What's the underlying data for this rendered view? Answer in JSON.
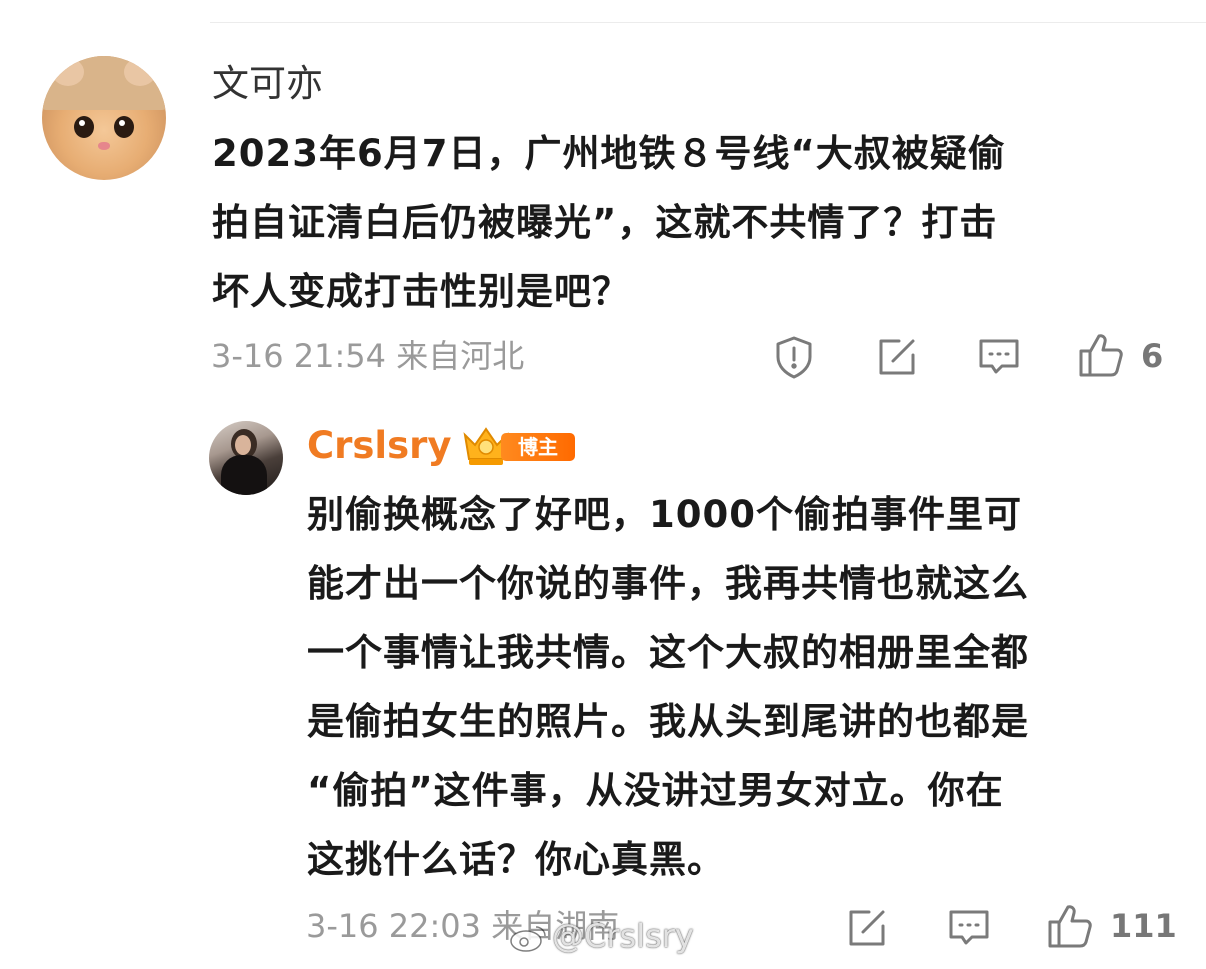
{
  "comment": {
    "author": "文可亦",
    "text_lines": [
      "2023年6月7日，广州地铁８号线“大叔被疑偷",
      "拍自证清白后仍被曝光”，这就不共情了？打击",
      "坏人变成打击性别是吧？"
    ],
    "meta": "3-16 21:54 来自河北",
    "like_count": "6",
    "icons": {
      "report": "shield-alert-icon",
      "forward": "edit-forward-icon",
      "reply": "comment-icon",
      "like": "thumbs-up-icon"
    }
  },
  "reply": {
    "author": "Crslsry",
    "badge": "博主",
    "text_lines": [
      "别偷换概念了好吧，1000个偷拍事件里可",
      "能才出一个你说的事件，我再共情也就这么",
      "一个事情让我共情。这个大叔的相册里全都",
      "是偷拍女生的照片。我从头到尾讲的也都是",
      "“偷拍”这件事，从没讲过男女对立。你在",
      "这挑什么话？你心真黑。"
    ],
    "meta": "3-16 22:03 来自湖南",
    "like_count": "111",
    "icons": {
      "forward": "edit-forward-icon",
      "reply": "comment-icon",
      "like": "thumbs-up-icon"
    }
  },
  "watermark": "@Crslsry",
  "colors": {
    "accent": "#f07b22",
    "badge": "#ff7a10",
    "text": "#1a1a1a",
    "meta": "#9a9a9a",
    "icon": "#7a7a7a"
  }
}
